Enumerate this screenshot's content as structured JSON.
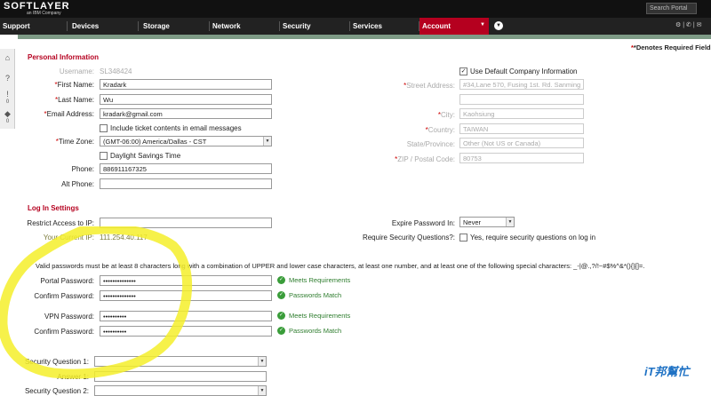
{
  "header": {
    "logo": "SOFTLAYER",
    "logo_sub": "an IBM Company",
    "search_placeholder": "Search Portal",
    "nav": [
      "Support",
      "Devices",
      "Storage",
      "Network",
      "Security",
      "Services",
      "Account"
    ]
  },
  "required_note": "*Denotes Required Fields",
  "personal": {
    "title": "Personal Information",
    "username_label": "Username:",
    "username_value": "SL348424",
    "first_name_label": "First Name:",
    "first_name_value": "Kradark",
    "last_name_label": "Last Name:",
    "last_name_value": "Wu",
    "email_label": "Email Address:",
    "email_value": "kradark@gmail.com",
    "include_ticket_label": "Include ticket contents in email messages",
    "timezone_label": "Time Zone:",
    "timezone_value": "(GMT-06:00) America/Dallas - CST",
    "dst_label": "Daylight Savings Time",
    "phone_label": "Phone:",
    "phone_value": "886911167325",
    "altphone_label": "Alt Phone:",
    "use_default_label": "Use Default Company Information",
    "street_label": "Street Address:",
    "street_value": "#34,Lane 570, Fusing 1st. Rd. Sanming",
    "city_label": "City:",
    "city_value": "Kaohsiung",
    "country_label": "Country:",
    "country_value": "TAIWAN",
    "state_label": "State/Province:",
    "state_value": "Other (Not US or Canada)",
    "zip_label": "ZIP / Postal Code:",
    "zip_value": "80753"
  },
  "login": {
    "title": "Log In Settings",
    "restrict_label": "Restrict Access to IP:",
    "current_ip_label": "Your Current IP:",
    "current_ip_value": "111.254.40.117",
    "expire_label": "Expire Password In:",
    "expire_value": "Never",
    "security_q_label": "Require Security Questions?:",
    "security_q_option": "Yes, require security questions on log in",
    "password_hint": "Valid passwords must be at least 8 characters long with a combination of UPPER and lower case characters, at least one number, and at least one of the following special characters: _-|@.,?/!~#$%^&*(){}[]=.",
    "portal_pw_label": "Portal Password:",
    "portal_pw_value": "••••••••••••••",
    "portal_pw_status": "Meets Requirements",
    "confirm_pw_label": "Confirm Password:",
    "confirm_pw_value": "••••••••••••••",
    "confirm_pw_status": "Passwords Match",
    "vpn_pw_label": "VPN Password:",
    "vpn_pw_value": "••••••••••",
    "vpn_pw_status": "Meets Requirements",
    "vpn_confirm_label": "Confirm Password:",
    "vpn_confirm_value": "••••••••••",
    "vpn_confirm_status": "Passwords Match",
    "sq1_label": "Security Question 1:",
    "answer1_label": "Answer 1:",
    "sq2_label": "Security Question 2:"
  },
  "sidebar_counts": [
    "0",
    "0"
  ],
  "watermark": "iT邦幫忙",
  "colors": {
    "accent": "#b5001f",
    "ok": "#3a9d3a",
    "highlight": "#f5ef2a"
  }
}
